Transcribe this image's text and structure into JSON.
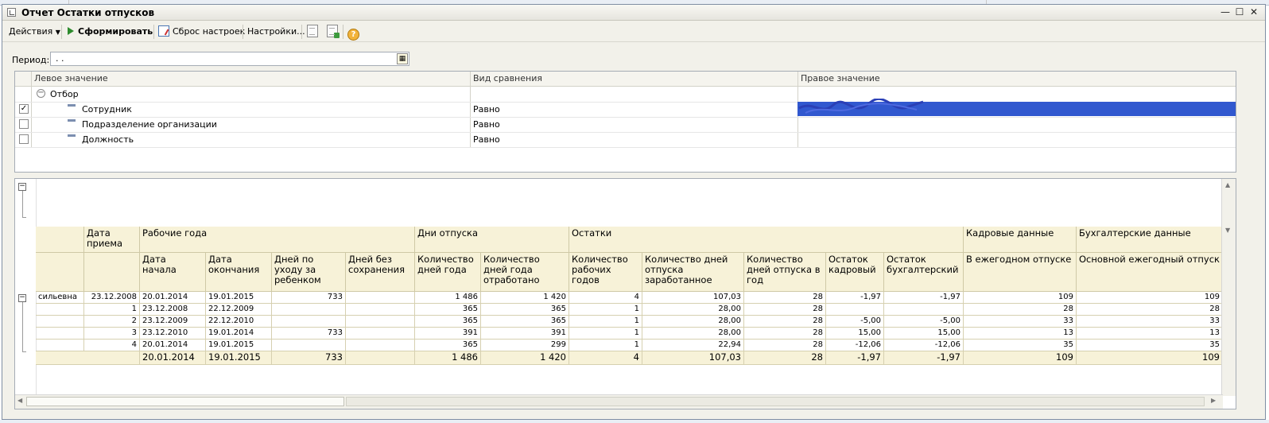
{
  "window": {
    "title": "Отчет  Остатки отпусков",
    "controls": {
      "minimize": "—",
      "maximize": "☐",
      "close": "✕"
    }
  },
  "toolbar": {
    "actions_label": "Действия",
    "generate_label": "Сформировать",
    "reset_label": "Сброс настроек",
    "settings_label": "Настройки...",
    "help_label": "?"
  },
  "period": {
    "label": "Период:",
    "value": ". ."
  },
  "filter": {
    "headers": [
      "Левое значение",
      "Вид сравнения",
      "Правое значение"
    ],
    "group_label": "Отбор",
    "rows": [
      {
        "checked": true,
        "left": "Сотрудник",
        "comparison": "Равно",
        "check_mark": "✓"
      },
      {
        "checked": false,
        "left": "Подразделение организации",
        "comparison": "Равно",
        "check_mark": ""
      },
      {
        "checked": false,
        "left": "Должность",
        "comparison": "Равно",
        "check_mark": ""
      }
    ]
  },
  "report": {
    "group_headers": {
      "hire_date": "Дата приема",
      "work_years": "Рабочие года",
      "vacation_days": "Дни отпуска",
      "balances": "Остатки",
      "hr_data": "Кадровые данные",
      "acc_data": "Бухгалтерские данные"
    },
    "sub_headers": {
      "start": "Дата начала",
      "end": "Дата окончания",
      "childcare": "Дней по уходу за ребенком",
      "unpaid": "Дней без сохранения",
      "days_year": "Количество дней года",
      "days_worked": "Количество дней года отработано",
      "work_years_count": "Количество рабочих годов",
      "earned": "Количество дней отпуска заработанное",
      "per_year": "Количество дней отпуска в год",
      "bal_hr": "Остаток кадровый",
      "bal_acc": "Остаток бухгалтерский",
      "annual_hr": "В ежегодном отпуске",
      "annual_acc": "Основной ежегодный отпуск"
    },
    "rows": [
      {
        "name": "сильевна",
        "hire": "23.12.2008",
        "start": "20.01.2014",
        "end": "19.01.2015",
        "childcare": "733",
        "unpaid": "",
        "days_year": "1 486",
        "days_worked": "1 420",
        "years": "4",
        "earned": "107,03",
        "per_year": "28",
        "bal_hr": "-1,97",
        "bal_acc": "-1,97",
        "hr": "109",
        "acc": "109"
      },
      {
        "name": "",
        "hire": "1",
        "start": "23.12.2008",
        "end": "22.12.2009",
        "childcare": "",
        "unpaid": "",
        "days_year": "365",
        "days_worked": "365",
        "years": "1",
        "earned": "28,00",
        "per_year": "28",
        "bal_hr": "",
        "bal_acc": "",
        "hr": "28",
        "acc": "28"
      },
      {
        "name": "",
        "hire": "2",
        "start": "23.12.2009",
        "end": "22.12.2010",
        "childcare": "",
        "unpaid": "",
        "days_year": "365",
        "days_worked": "365",
        "years": "1",
        "earned": "28,00",
        "per_year": "28",
        "bal_hr": "-5,00",
        "bal_acc": "-5,00",
        "hr": "33",
        "acc": "33"
      },
      {
        "name": "",
        "hire": "3",
        "start": "23.12.2010",
        "end": "19.01.2014",
        "childcare": "733",
        "unpaid": "",
        "days_year": "391",
        "days_worked": "391",
        "years": "1",
        "earned": "28,00",
        "per_year": "28",
        "bal_hr": "15,00",
        "bal_acc": "15,00",
        "hr": "13",
        "acc": "13"
      },
      {
        "name": "",
        "hire": "4",
        "start": "20.01.2014",
        "end": "19.01.2015",
        "childcare": "",
        "unpaid": "",
        "days_year": "365",
        "days_worked": "299",
        "years": "1",
        "earned": "22,94",
        "per_year": "28",
        "bal_hr": "-12,06",
        "bal_acc": "-12,06",
        "hr": "35",
        "acc": "35"
      }
    ],
    "totals": {
      "start": "20.01.2014",
      "end": "19.01.2015",
      "childcare": "733",
      "unpaid": "",
      "days_year": "1 486",
      "days_worked": "1 420",
      "years": "4",
      "earned": "107,03",
      "per_year": "28",
      "bal_hr": "-1,97",
      "bal_acc": "-1,97",
      "hr": "109",
      "acc": "109"
    }
  },
  "colors": {
    "header_bg": "#f7f2d8",
    "selection": "#3158cf",
    "window_bg": "#f2f1ea"
  },
  "icons": [
    "app-icon",
    "play-icon",
    "reset-icon",
    "doc-icon",
    "export-icon",
    "help-icon",
    "calendar-icon",
    "checkbox-icon",
    "collapse-icon"
  ]
}
